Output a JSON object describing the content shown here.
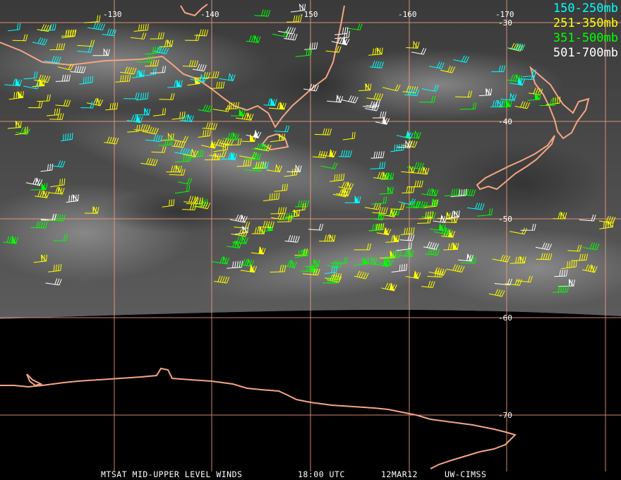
{
  "map": {
    "longitude_labels": [
      "-130",
      "-140",
      "-150",
      "-160",
      "-170"
    ],
    "latitude_labels": [
      "-30",
      "-40",
      "-50",
      "-60",
      "-70"
    ],
    "colors": {
      "grid": "#f0a080",
      "coast": "#f4a584",
      "ocean_dark": "#000000"
    }
  },
  "legend": {
    "items": [
      {
        "label": "150-250mb",
        "color": "#00ffff"
      },
      {
        "label": "251-350mb",
        "color": "#ffff00"
      },
      {
        "label": "351-500mb",
        "color": "#00ff00"
      },
      {
        "label": "501-700mb",
        "color": "#ffffff"
      }
    ]
  },
  "caption": {
    "product": "MTSAT MID-UPPER LEVEL WINDS",
    "time": "18:00 UTC",
    "date": "12MAR12",
    "source": "UW-CIMSS"
  }
}
